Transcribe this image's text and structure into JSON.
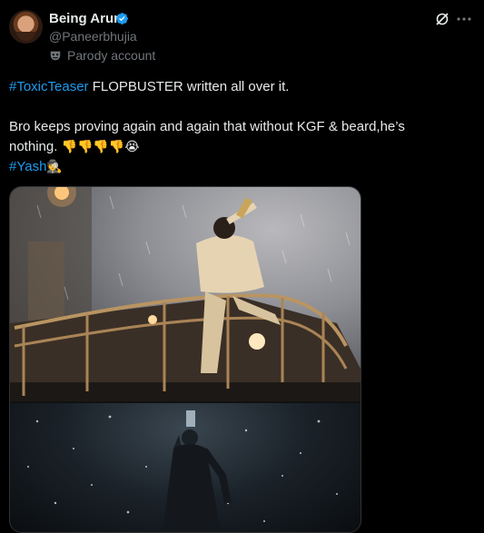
{
  "author": {
    "name": "Being Arun",
    "handle": "@Paneerbhujia",
    "label": "Parody account",
    "verified": true
  },
  "tweet": {
    "line1_hashtag": "#ToxicTeaser",
    "line1_text": " FLOPBUSTER written all over it.",
    "line2": "Bro keeps proving again and again that without KGF & beard,he’s",
    "line3_text": "nothing. ",
    "line3_emojis": "👎👎👎👎😭",
    "line4_hashtag": "#Yash",
    "line4_emoji": "🕵"
  },
  "icons": {
    "verified": "verified-badge-icon",
    "parody": "mask-icon",
    "grok": "grok-icon",
    "more": "more-icon"
  },
  "colors": {
    "background": "#000000",
    "text": "#e7e9ea",
    "secondary": "#71767b",
    "link": "#1d9bf0"
  }
}
